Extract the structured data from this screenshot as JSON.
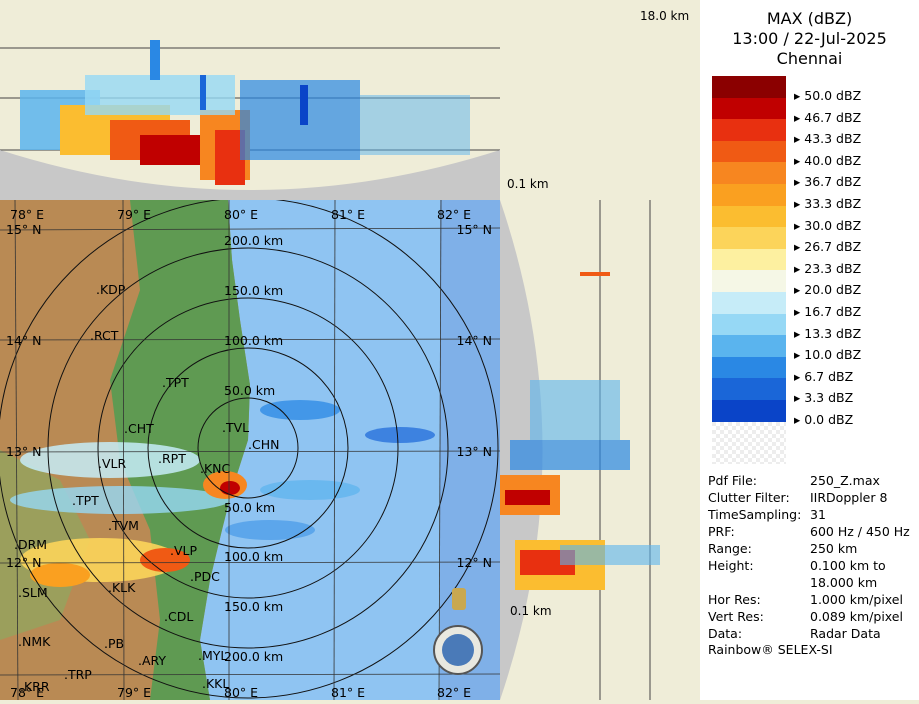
{
  "header": {
    "product": "MAX (dBZ)",
    "time_date": "13:00 / 22-Jul-2025",
    "station": "Chennai"
  },
  "top_profile": {
    "height_label": "18.0 km"
  },
  "side_profile": {
    "height_label": "0.1 km",
    "range_bottom": "0.1 km"
  },
  "legend": {
    "items": [
      {
        "label": "50.0 dBZ",
        "color": "#8b0000"
      },
      {
        "label": "46.7 dBZ",
        "color": "#c00000"
      },
      {
        "label": "43.3 dBZ",
        "color": "#e83010"
      },
      {
        "label": "40.0 dBZ",
        "color": "#f05a14"
      },
      {
        "label": "36.7 dBZ",
        "color": "#f78620"
      },
      {
        "label": "33.3 dBZ",
        "color": "#faa020"
      },
      {
        "label": "30.0 dBZ",
        "color": "#fbbd30"
      },
      {
        "label": "26.7 dBZ",
        "color": "#fcd45a"
      },
      {
        "label": "23.3 dBZ",
        "color": "#fdf0a0"
      },
      {
        "label": "20.0 dBZ",
        "color": "#f5f7e6"
      },
      {
        "label": "16.7 dBZ",
        "color": "#c6ecf8"
      },
      {
        "label": "13.3 dBZ",
        "color": "#96d8f5"
      },
      {
        "label": "10.0 dBZ",
        "color": "#5ab4ee"
      },
      {
        "label": "6.7 dBZ",
        "color": "#2a88e4"
      },
      {
        "label": "3.3 dBZ",
        "color": "#1a66d8"
      },
      {
        "label": "0.0 dBZ",
        "color": "#0a44c8"
      }
    ]
  },
  "info": [
    {
      "label": "Pdf File:",
      "value": "250_Z.max"
    },
    {
      "label": "Clutter Filter:",
      "value": "IIRDoppler 8"
    },
    {
      "label": "TimeSampling:",
      "value": "31"
    },
    {
      "label": "PRF:",
      "value": "600 Hz / 450 Hz"
    },
    {
      "label": "Range:",
      "value": "250 km"
    },
    {
      "label": "Height:",
      "value": "0.100 km to"
    },
    {
      "label": "",
      "value": "18.000 km"
    },
    {
      "label": "Hor Res:",
      "value": "1.000 km/pixel"
    },
    {
      "label": "Vert Res:",
      "value": "0.089 km/pixel"
    },
    {
      "label": "Data:",
      "value": "Radar Data"
    }
  ],
  "footer": "Rainbow® SELEX-SI",
  "map": {
    "lon_labels": [
      "78° E",
      "79° E",
      "80° E",
      "81° E",
      "82° E"
    ],
    "lat_labels": [
      "15° N",
      "14° N",
      "13° N",
      "12° N"
    ],
    "range_labels": [
      "200.0 km",
      "150.0 km",
      "100.0 km",
      "50.0 km",
      "50.0 km",
      "100.0 km",
      "150.0 km",
      "200.0 km"
    ],
    "cities": [
      "KDP",
      "RCT",
      "TPT",
      "CHT",
      "TVL",
      "CHN",
      "VLR",
      "RPT",
      "KNC",
      "TPT",
      "TVM",
      "DRM",
      "VLP",
      "SLM",
      "KLK",
      "PDC",
      "CDL",
      "NMK",
      "PB",
      "ARY",
      "MYL",
      "TRP",
      "KRR",
      "KKL"
    ],
    "colors": {
      "land_green": "#5f9a52",
      "land_brown": "#b98a54",
      "sea": "#8fc4f2",
      "sea_far": "#7fb0e8"
    }
  }
}
